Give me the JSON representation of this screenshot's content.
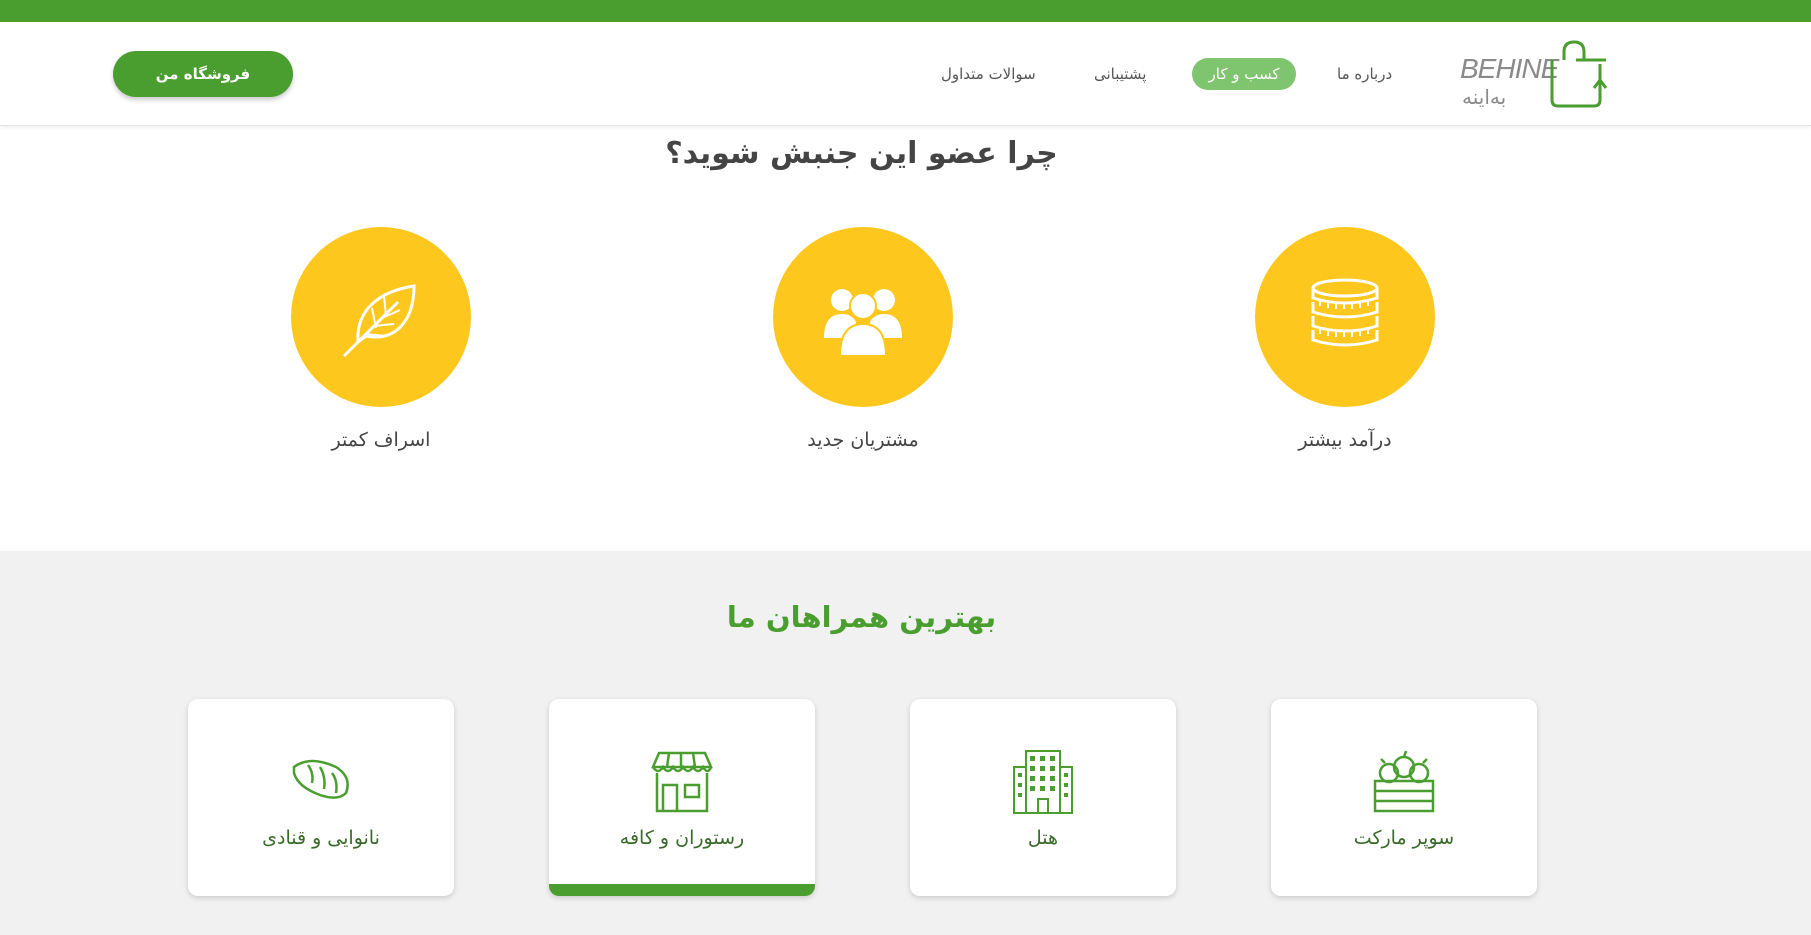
{
  "header": {
    "shop_button": "فروشگاه من",
    "nav": {
      "faq": "سوالات متداول",
      "support": "پشتیبانی",
      "business": "کسب و کار",
      "about": "درباره ما"
    },
    "logo_text": "BEHINE",
    "logo_text_fa": "به‌اینه"
  },
  "why_section": {
    "title": "چرا عضو این جنبش شوید؟",
    "features": [
      {
        "label": "اسراف کمتر",
        "icon": "leaf-icon"
      },
      {
        "label": "مشتریان جدید",
        "icon": "users-icon"
      },
      {
        "label": "درآمد بیشتر",
        "icon": "coins-icon"
      }
    ]
  },
  "partners_section": {
    "title": "بهترین همراهان ما",
    "cards": [
      {
        "label": "نانوایی و قنادی",
        "icon": "bread-icon"
      },
      {
        "label": "رستوران و کافه",
        "icon": "store-icon"
      },
      {
        "label": "هتل",
        "icon": "hotel-building-icon"
      },
      {
        "label": "سوپر مارکت",
        "icon": "fruit-crate-icon"
      }
    ]
  },
  "colors": {
    "brand_green": "#4a9e2f",
    "active_nav": "#7fc46e",
    "feature_yellow": "#fdc71d",
    "section_gray": "#f1f1f1"
  }
}
